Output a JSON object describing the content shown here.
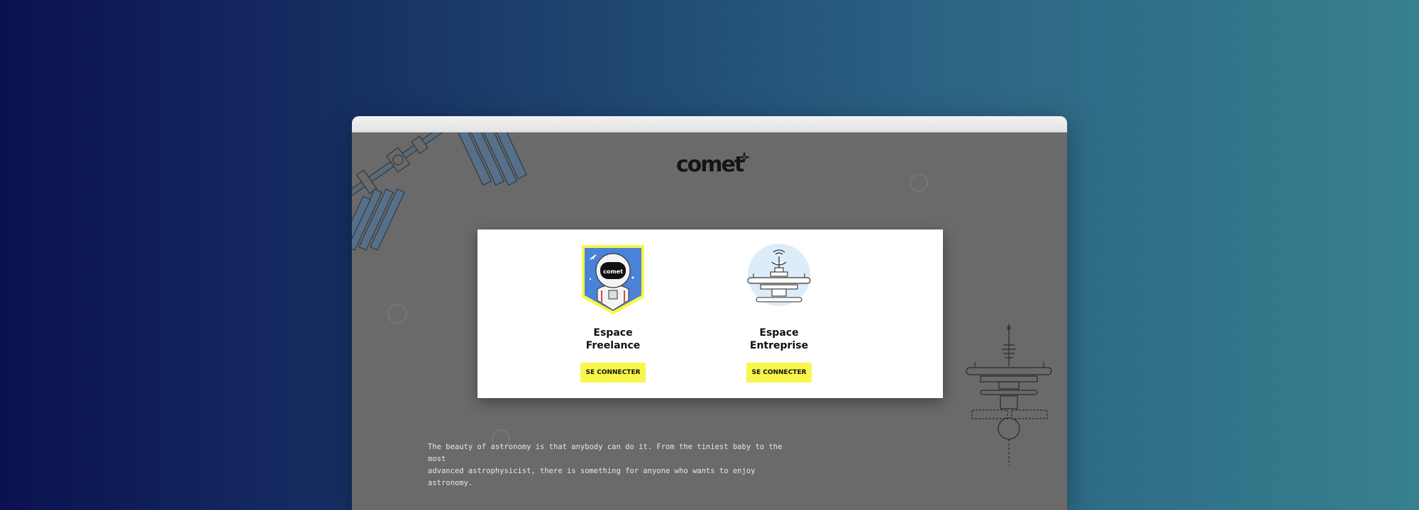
{
  "page": {
    "background_colors": [
      "#0b1150",
      "#37808e"
    ]
  },
  "browser": {
    "viewport_bg": "#6a6a6a"
  },
  "logo": {
    "text": "comet",
    "icon": "sparkle-icon"
  },
  "modal": {
    "spaces": [
      {
        "title_line1": "Espace",
        "title_line2": "Freelance",
        "button_label": "SE CONNECTER",
        "icon": "astronaut-badge-icon"
      },
      {
        "title_line1": "Espace",
        "title_line2": "Entreprise",
        "button_label": "SE CONNECTER",
        "icon": "space-station-icon"
      }
    ],
    "button_color": "#f8f64a"
  },
  "quote": {
    "line1": "The beauty of astronomy is that anybody can do it. From the tiniest baby to the most",
    "line2": "advanced astrophysicist, there is something for anyone who wants to enjoy astronomy."
  }
}
